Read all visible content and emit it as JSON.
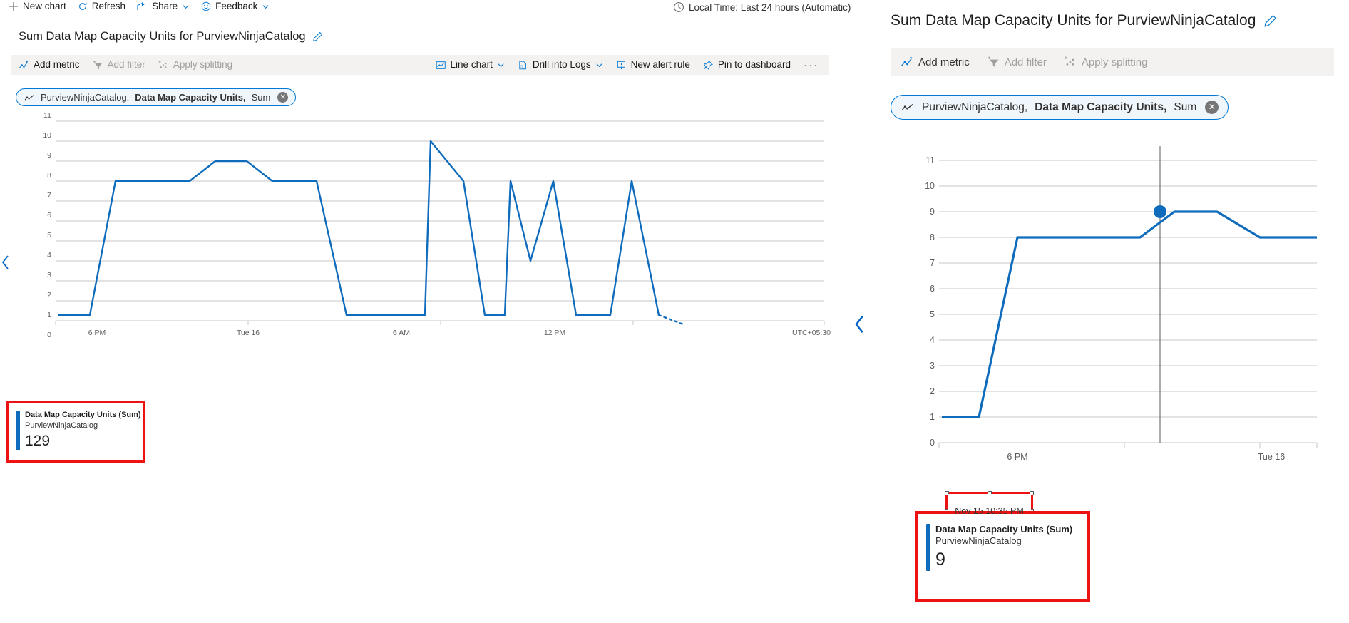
{
  "left": {
    "commandbar": [
      {
        "label": "New chart",
        "icon": "plus-icon",
        "caret": false,
        "disabled": false
      },
      {
        "label": "Refresh",
        "icon": "refresh-icon",
        "caret": false,
        "disabled": false
      },
      {
        "label": "Share",
        "icon": "share-icon",
        "caret": true,
        "disabled": false
      },
      {
        "label": "Feedback",
        "icon": "feedback-smiley-icon",
        "caret": true,
        "disabled": false
      }
    ],
    "time_picker": "Local Time: Last 24 hours (Automatic)",
    "title": "Sum Data Map Capacity Units for PurviewNinjaCatalog",
    "chart_toolbar_left": [
      {
        "label": "Add metric",
        "icon": "add-metric-icon",
        "disabled": false
      },
      {
        "label": "Add filter",
        "icon": "add-filter-icon",
        "disabled": true
      },
      {
        "label": "Apply splitting",
        "icon": "apply-splitting-icon",
        "disabled": true
      }
    ],
    "chart_toolbar_right": [
      {
        "label": "Line chart",
        "icon": "line-chart-icon",
        "caret": true
      },
      {
        "label": "Drill into Logs",
        "icon": "drill-into-logs-icon",
        "caret": true
      },
      {
        "label": "New alert rule",
        "icon": "new-alert-rule-icon",
        "caret": false
      },
      {
        "label": "Pin to dashboard",
        "icon": "pin-icon",
        "caret": false
      }
    ],
    "more_label": "···",
    "metric_pill": {
      "resource": "PurviewNinjaCatalog,",
      "metric": "Data Map Capacity Units,",
      "aggregation": "Sum",
      "close": "✕"
    },
    "legend": {
      "title": "Data Map Capacity Units (Sum)",
      "subtitle": "PurviewNinjaCatalog",
      "value": "129"
    }
  },
  "right": {
    "title": "Sum Data Map Capacity Units for PurviewNinjaCatalog",
    "chart_toolbar": [
      {
        "label": "Add metric",
        "icon": "add-metric-icon",
        "disabled": false
      },
      {
        "label": "Add filter",
        "icon": "add-filter-icon",
        "disabled": true
      },
      {
        "label": "Apply splitting",
        "icon": "apply-splitting-icon",
        "disabled": true
      }
    ],
    "metric_pill": {
      "resource": "PurviewNinjaCatalog,",
      "metric": "Data Map Capacity Units,",
      "aggregation": "Sum",
      "close": "✕"
    },
    "tooltip": "Nov 15 10:35 PM",
    "legend": {
      "title": "Data Map Capacity Units (Sum)",
      "subtitle": "PurviewNinjaCatalog",
      "value": "9"
    }
  },
  "colors": {
    "series": "#0f6cbd",
    "accent": "#0078d4",
    "callout_red": "#ee1111",
    "grid": "#c8c6c4",
    "toolbar_bg": "#f3f2f1",
    "pill_bg": "#eff6fc",
    "disabled_text": "#a19f9d"
  },
  "chart_data": [
    {
      "id": "left-chart",
      "type": "line",
      "title": "Sum Data Map Capacity Units for PurviewNinjaCatalog",
      "xlabel": "",
      "ylabel": "",
      "ylim": [
        0,
        11
      ],
      "yticks": [
        0,
        1,
        2,
        3,
        4,
        5,
        6,
        7,
        8,
        9,
        10,
        11
      ],
      "xtick_labels": [
        "6 PM",
        "Tue 16",
        "6 AM",
        "12 PM"
      ],
      "timezone_label": "UTC+05:30",
      "grid": true,
      "legend_position": "bottom-left",
      "series": [
        {
          "name": "Data Map Capacity Units (Sum) - PurviewNinjaCatalog",
          "color": "#0f6cbd",
          "total": 129,
          "x": [
            0,
            3,
            5,
            17,
            20,
            26,
            31,
            33,
            40,
            44,
            48,
            51,
            57,
            60,
            64,
            68,
            72,
            75,
            81,
            85,
            88,
            92,
            96,
            100
          ],
          "values": [
            1,
            1,
            8,
            8,
            9,
            9,
            8,
            8,
            1,
            1,
            1,
            10,
            8,
            1,
            8,
            4,
            8,
            1,
            1,
            8,
            0.6,
            0.4,
            0.3,
            0.2
          ]
        }
      ]
    },
    {
      "id": "right-chart",
      "type": "line",
      "title": "Sum Data Map Capacity Units for PurviewNinjaCatalog",
      "xlabel": "",
      "ylabel": "",
      "ylim": [
        0,
        11
      ],
      "yticks": [
        0,
        1,
        2,
        3,
        4,
        5,
        6,
        7,
        8,
        9,
        10,
        11
      ],
      "xtick_labels": [
        "6 PM",
        "Tue 16"
      ],
      "grid": true,
      "legend_position": "bottom-left",
      "hover": {
        "x_value": "Nov 15 10:35 PM",
        "y_value": 9
      },
      "series": [
        {
          "name": "Data Map Capacity Units (Sum) - PurviewNinjaCatalog",
          "color": "#0f6cbd",
          "x": [
            0,
            11,
            22,
            62,
            74,
            86,
            96,
            100
          ],
          "values": [
            1,
            1,
            8,
            8,
            9,
            9,
            8,
            8
          ]
        }
      ]
    }
  ]
}
